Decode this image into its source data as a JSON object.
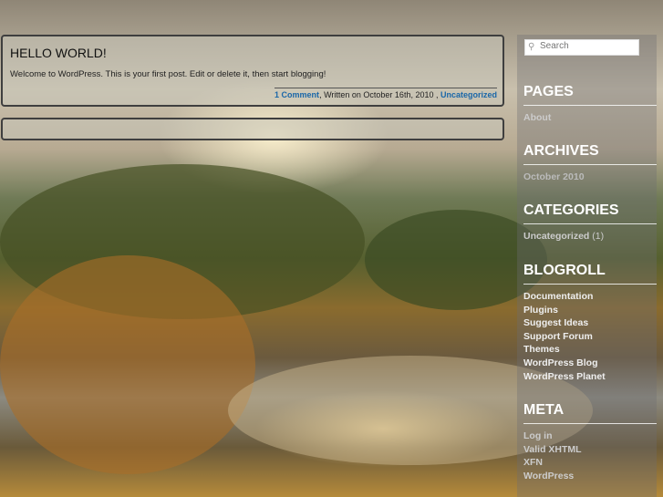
{
  "post": {
    "title": "HELLO WORLD!",
    "body": "Welcome to WordPress. This is your first post. Edit or delete it, then start blogging!",
    "comments": "1 Comment",
    "written": ", Written on October 16th, 2010 , ",
    "category": "Uncategorized"
  },
  "sidebar": {
    "search_placeholder": "Search",
    "pages": {
      "title": "PAGES",
      "items": [
        "About"
      ]
    },
    "archives": {
      "title": "ARCHIVES",
      "items": [
        "October 2010"
      ]
    },
    "categories": {
      "title": "CATEGORIES",
      "item": "Uncategorized",
      "count": "(1)"
    },
    "blogroll": {
      "title": "BLOGROLL",
      "items": [
        "Documentation",
        "Plugins",
        "Suggest Ideas",
        "Support Forum",
        "Themes",
        "WordPress Blog",
        "WordPress Planet"
      ]
    },
    "meta": {
      "title": "META",
      "items": [
        "Log in",
        "Valid XHTML",
        "XFN",
        "WordPress"
      ]
    }
  }
}
